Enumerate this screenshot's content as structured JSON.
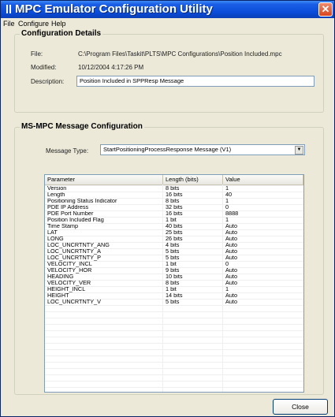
{
  "window": {
    "title": "MPC Emulator Configuration Utility",
    "close_glyph": "✕",
    "title_color": "#0a4bd8"
  },
  "menu": {
    "items": [
      "File",
      "Configure",
      "Help"
    ]
  },
  "config_details": {
    "title": "Configuration Details",
    "file_label": "File:",
    "file_value": "C:\\Program Files\\Taskit\\PLTS\\MPC Configurations\\Position Included.mpc",
    "modified_label": "Modified:",
    "modified_value": "10/12/2004 4:17:26 PM",
    "description_label": "Description:",
    "description_value": "Position Included in SPPResp Message"
  },
  "message_config": {
    "title": "MS-MPC Message Configuration",
    "type_label": "Message Type:",
    "type_value": "StartPositioningProcessResponse Message (V1)",
    "dropdown_icon": "chevron-down-icon"
  },
  "table": {
    "headers": [
      "Parameter",
      "Length (bits)",
      "Value"
    ],
    "rows": [
      [
        "Version",
        "8 bits",
        "1"
      ],
      [
        "Length",
        "16 bits",
        "40"
      ],
      [
        "Positioning Status Indicator",
        "8 bits",
        "1"
      ],
      [
        "PDE IP Address",
        "32 bits",
        "0"
      ],
      [
        "PDE Port Number",
        "16 bits",
        "8888"
      ],
      [
        "Position Included Flag",
        "1 bit",
        "1"
      ],
      [
        "Time Stamp",
        "40 bits",
        "Auto"
      ],
      [
        "LAT",
        "25 bits",
        "Auto"
      ],
      [
        "LONG",
        "26 bits",
        "Auto"
      ],
      [
        "LOC_UNCRTNTY_ANG",
        "4 bits",
        "Auto"
      ],
      [
        "LOC_UNCRTNTY_A",
        "5 bits",
        "Auto"
      ],
      [
        "LOC_UNCRTNTY_P",
        "5 bits",
        "Auto"
      ],
      [
        "VELOCITY_INCL",
        "1 bit",
        "0"
      ],
      [
        "VELOCITY_HOR",
        "9 bits",
        "Auto"
      ],
      [
        "HEADING",
        "10 bits",
        "Auto"
      ],
      [
        "VELOCITY_VER",
        "8 bits",
        "Auto"
      ],
      [
        "HEIGHT_INCL",
        "1 bit",
        "1"
      ],
      [
        "HEIGHT",
        "14 bits",
        "Auto"
      ],
      [
        "LOC_UNCRTNTY_V",
        "5 bits",
        "Auto"
      ]
    ]
  },
  "buttons": {
    "close_label": "Close"
  }
}
